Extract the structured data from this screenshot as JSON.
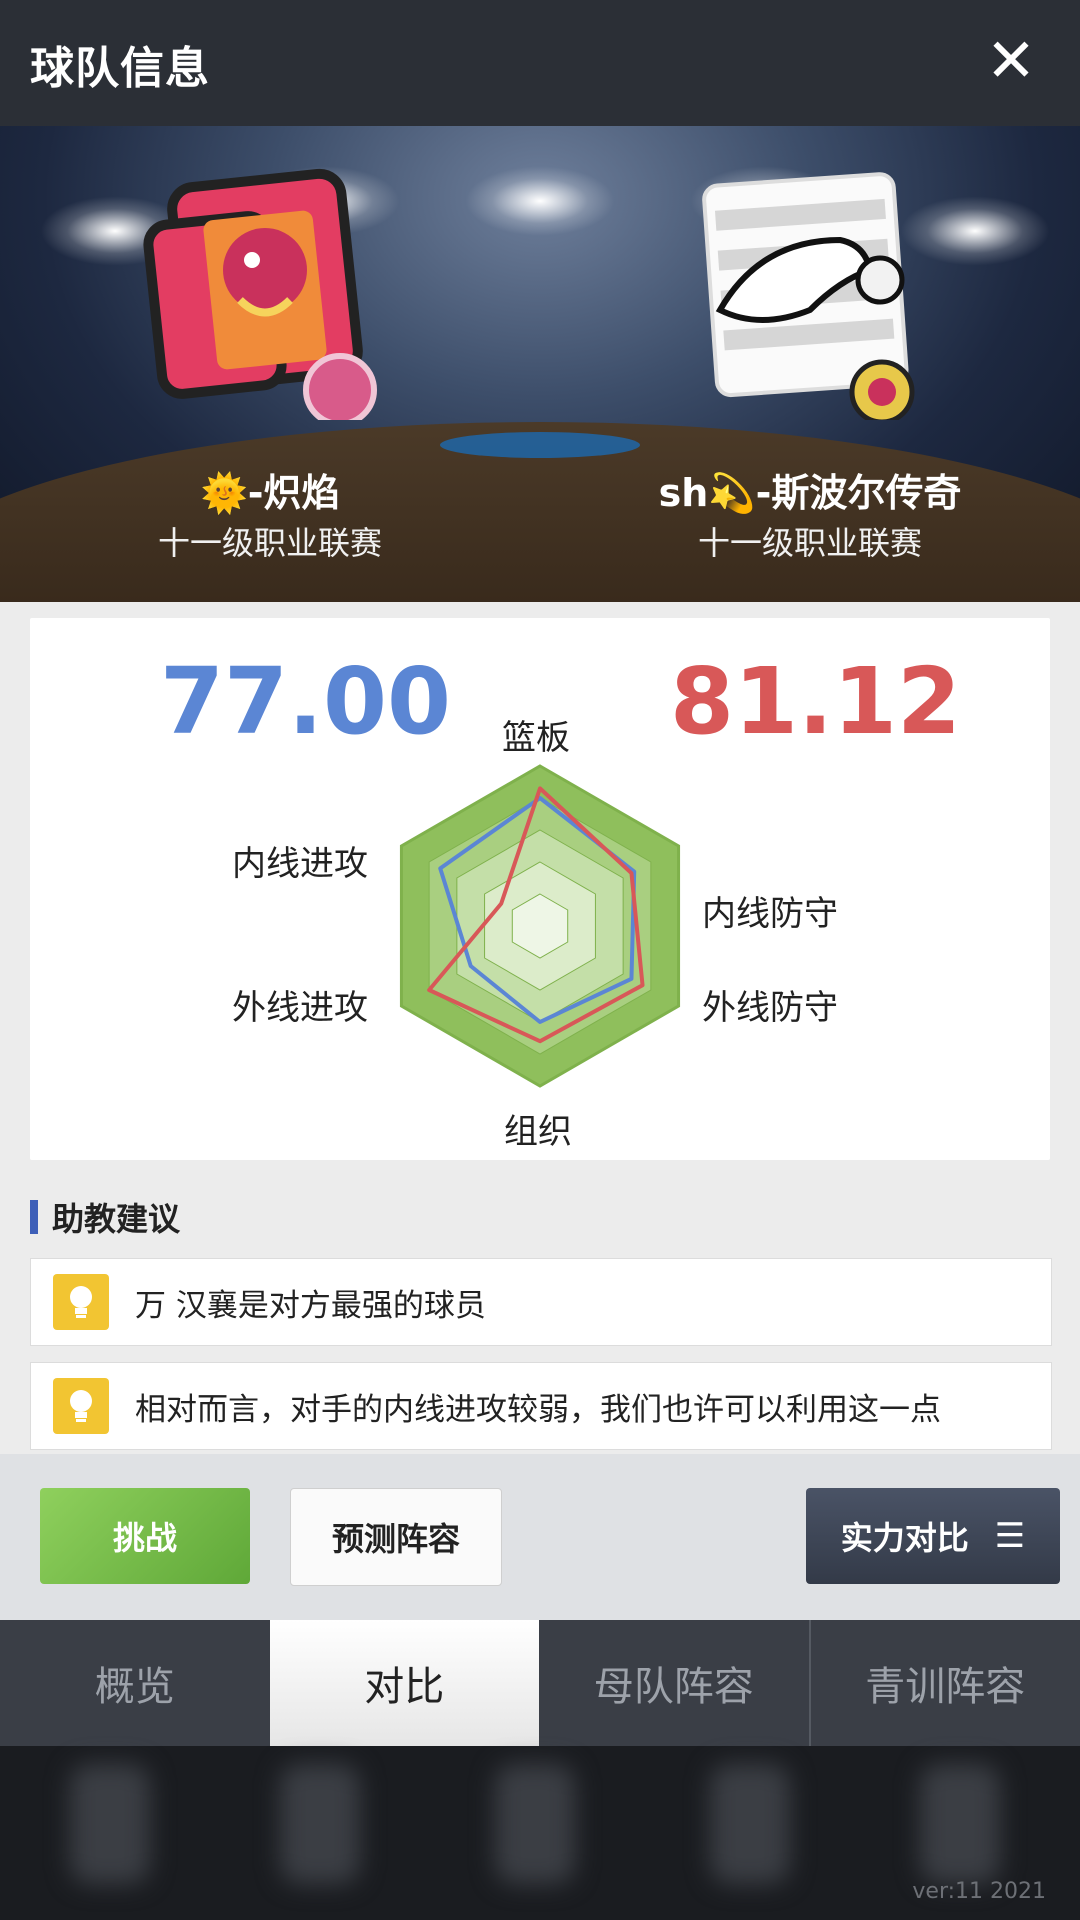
{
  "header": {
    "title": "球队信息",
    "close_icon": "close-icon"
  },
  "teams": {
    "left": {
      "name": "🌞-炽焰",
      "league": "十一级职业联赛",
      "logo_icon": "dragon-logo-icon"
    },
    "right": {
      "name": "sh💫-斯波尔传奇",
      "league": "十一级职业联赛",
      "logo_icon": "shark-logo-icon"
    }
  },
  "compare": {
    "left_score": "77.00",
    "right_score": "81.12",
    "colors": {
      "left": "#5b86d4",
      "right": "#d85858",
      "radar_fill": "#8fbf5c"
    },
    "radar": {
      "labels": {
        "rebound": "篮板",
        "inside_defense": "内线防守",
        "outside_defense": "外线防守",
        "organize": "组织",
        "outside_attack": "外线进攻",
        "inside_attack": "内线进攻"
      },
      "left_values": [
        0.8,
        0.68,
        0.66,
        0.6,
        0.5,
        0.72
      ],
      "right_values": [
        0.86,
        0.66,
        0.74,
        0.72,
        0.8,
        0.28
      ]
    }
  },
  "advice": {
    "heading": "助教建议",
    "tips": [
      {
        "icon": "lightbulb-icon",
        "text": "万 汉襄是对方最强的球员"
      },
      {
        "icon": "lightbulb-icon",
        "text": "相对而言，对手的内线进攻较弱，我们也许可以利用这一点"
      }
    ]
  },
  "actions": {
    "challenge": "挑战",
    "predict_lineup": "预测阵容",
    "strength_compare": "实力对比",
    "menu_icon": "menu-icon"
  },
  "tabs": [
    "概览",
    "对比",
    "母队阵容",
    "青训阵容"
  ],
  "active_tab": "对比",
  "footer": {
    "version": "ver:11   2021"
  }
}
